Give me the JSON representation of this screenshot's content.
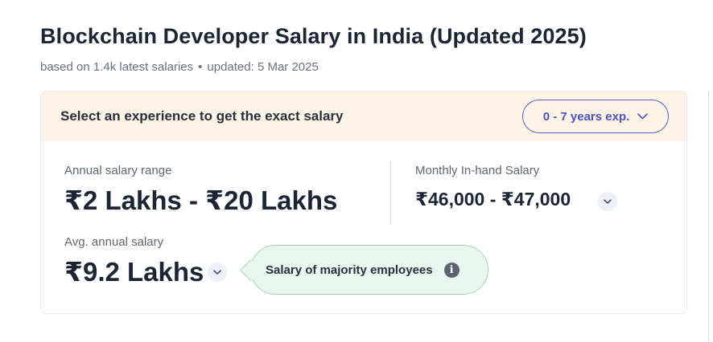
{
  "page": {
    "title": "Blockchain Developer Salary in India (Updated 2025)",
    "subtitle_salaries": "based on 1.4k latest salaries",
    "subtitle_separator": "•",
    "subtitle_updated": "updated: 5 Mar 2025"
  },
  "card": {
    "header_text": "Select an experience to get the exact salary",
    "experience_select": {
      "selected": "0 - 7 years exp.",
      "icon": "chevron-down-icon"
    },
    "annual_range": {
      "label": "Annual salary range",
      "value": "₹2 Lakhs - ₹20 Lakhs"
    },
    "monthly_inhand": {
      "label": "Monthly In-hand Salary",
      "value": "₹46,000 - ₹47,000",
      "icon": "chevron-down-icon"
    },
    "avg_annual": {
      "label": "Avg. annual salary",
      "value": "₹9.2 Lakhs",
      "icon": "chevron-down-icon"
    },
    "tooltip": {
      "text": "Salary of majority employees",
      "icon": "info-icon",
      "icon_glyph": "i"
    }
  },
  "colors": {
    "accent": "#4a53c7",
    "header_bg": "#fdf3e6",
    "tooltip_bg": "#e8f6ef",
    "tooltip_border": "#9fd6b8",
    "text_dark": "#1c2436"
  }
}
